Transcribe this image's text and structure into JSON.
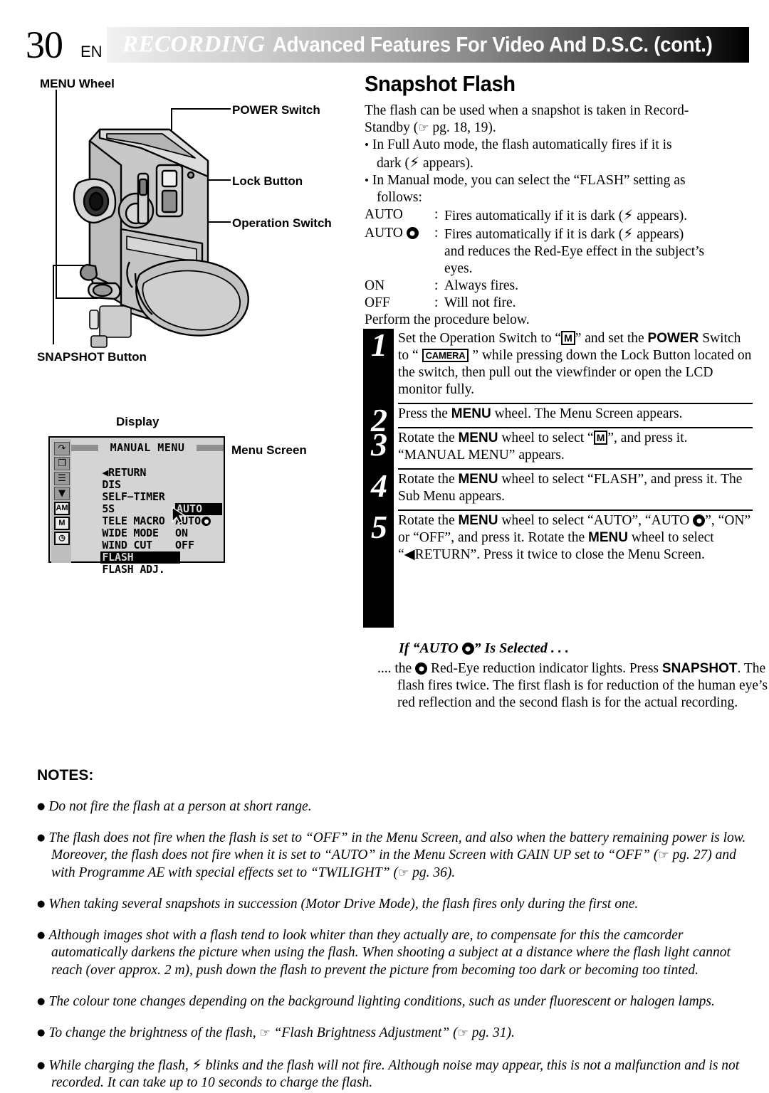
{
  "header": {
    "page_number": "30",
    "language": "EN",
    "title_italic": "RECORDING",
    "title_rest": "Advanced Features For Video And D.S.C. (cont.)"
  },
  "callouts": {
    "menu_wheel": "MENU Wheel",
    "power_switch": "POWER Switch",
    "lock_button": "Lock Button",
    "operation_switch": "Operation Switch",
    "snapshot_button": "SNAPSHOT Button",
    "display": "Display",
    "menu_screen": "Menu Screen"
  },
  "menu_screen": {
    "title": "MANUAL MENU",
    "side_icons": [
      "return-arrow-icon",
      "copy-icon",
      "camera-setup-icon",
      "system-icon",
      "auto-manual-icon",
      "manual-mode-icon",
      "clock-icon"
    ],
    "side_icon_glyphs": [
      "↵",
      "❐",
      "☰",
      "▼",
      "AM",
      "M",
      "◷"
    ],
    "rows": [
      {
        "label": "◀RETURN",
        "value": "",
        "label_highlight": false,
        "value_highlight": false
      },
      {
        "label": "DIS",
        "value": "",
        "label_highlight": false,
        "value_highlight": false
      },
      {
        "label": "SELF−TIMER",
        "value": "",
        "label_highlight": false,
        "value_highlight": false
      },
      {
        "label": "5S",
        "value": "",
        "label_highlight": false,
        "value_highlight": false
      },
      {
        "label": "TELE MACRO",
        "value": "AUTO",
        "label_highlight": false,
        "value_highlight": true
      },
      {
        "label": "WIDE MODE",
        "value": "AUTO",
        "value_eye": true,
        "label_highlight": false,
        "value_highlight": false
      },
      {
        "label": "WIND CUT",
        "value": "ON",
        "label_highlight": false,
        "value_highlight": false
      },
      {
        "label": "FLASH",
        "value": "OFF",
        "label_highlight": true,
        "value_highlight": false
      },
      {
        "label": "FLASH ADJ.",
        "value": "",
        "label_highlight": false,
        "value_highlight": false
      }
    ]
  },
  "main": {
    "heading": "Snapshot Flash",
    "intro_1": "The flash can be used when a snapshot is taken in Record-",
    "intro_2_prefix": "Standby (",
    "intro_2_suffix": " pg. 18, 19).",
    "bullet_1a": "In Full Auto mode, the flash automatically fires if it is",
    "bullet_1b_prefix": "dark (",
    "bullet_1b_suffix": " appears).",
    "bullet_2a": "In Manual mode, you can select the “FLASH” setting as",
    "bullet_2b": "follows:",
    "modes": [
      {
        "key": "AUTO",
        "key_eye": false,
        "colon": ":",
        "desc_pre": "Fires automatically if it is dark (",
        "desc_post": " appears)."
      },
      {
        "key": "AUTO",
        "key_eye": true,
        "colon": ":",
        "desc_pre": "Fires automatically if it is dark (",
        "desc_post": " appears)",
        "desc_line2": "and reduces the Red-Eye effect in the subject’s",
        "desc_line3": "eyes."
      },
      {
        "key": "ON",
        "key_eye": false,
        "colon": ":",
        "desc_plain": "Always fires."
      },
      {
        "key": "OFF",
        "key_eye": false,
        "colon": ":",
        "desc_plain": "Will not fire."
      }
    ],
    "perform": "Perform the procedure below."
  },
  "steps": [
    {
      "number": "1",
      "parts": [
        {
          "t": "text",
          "v": "Set the Operation Switch to “"
        },
        {
          "t": "boxM",
          "v": "M"
        },
        {
          "t": "text",
          "v": "” and set the "
        },
        {
          "t": "bold",
          "v": "POWER"
        },
        {
          "t": "text",
          "v": " Switch to “ "
        },
        {
          "t": "boxCAM",
          "v": "CAMERA"
        },
        {
          "t": "text",
          "v": " ” while pressing down the Lock Button located on the switch, then pull out the viewfinder or open the LCD monitor fully."
        }
      ]
    },
    {
      "number": "2",
      "parts": [
        {
          "t": "text",
          "v": "Press the "
        },
        {
          "t": "bold",
          "v": "MENU"
        },
        {
          "t": "text",
          "v": " wheel. The Menu Screen appears."
        }
      ]
    },
    {
      "number": "3",
      "parts": [
        {
          "t": "text",
          "v": "Rotate the "
        },
        {
          "t": "bold",
          "v": "MENU"
        },
        {
          "t": "text",
          "v": " wheel to select “"
        },
        {
          "t": "boxM",
          "v": "M"
        },
        {
          "t": "text",
          "v": "”, and press it. “MANUAL MENU” appears."
        }
      ]
    },
    {
      "number": "4",
      "parts": [
        {
          "t": "text",
          "v": "Rotate the "
        },
        {
          "t": "bold",
          "v": "MENU"
        },
        {
          "t": "text",
          "v": " wheel to select “FLASH”, and press it. The Sub Menu appears."
        }
      ]
    },
    {
      "number": "5",
      "parts": [
        {
          "t": "text",
          "v": "Rotate the "
        },
        {
          "t": "bold",
          "v": "MENU"
        },
        {
          "t": "text",
          "v": " wheel to select “AUTO”, “AUTO "
        },
        {
          "t": "eye",
          "v": ""
        },
        {
          "t": "text",
          "v": "”, “ON” or “OFF”, and press it. Rotate the "
        },
        {
          "t": "bold",
          "v": "MENU"
        },
        {
          "t": "text",
          "v": " wheel to select “◀RETURN”. Press it twice to close the Menu Screen."
        }
      ]
    }
  ],
  "if_auto": {
    "heading_pre": "If “AUTO ",
    "heading_post": "” Is Selected . . .",
    "body_parts": [
      {
        "t": "text",
        "v": ".... the "
      },
      {
        "t": "eye",
        "v": ""
      },
      {
        "t": "text",
        "v": " Red-Eye reduction indicator lights. Press "
      },
      {
        "t": "bold",
        "v": "SNAPSHOT"
      },
      {
        "t": "text",
        "v": ". The flash fires twice. The first flash is for reduction of the human eye’s red reflection and the second flash is for the actual recording."
      }
    ]
  },
  "notes": {
    "title": "NOTES:",
    "items": [
      [
        {
          "t": "text",
          "v": "Do not fire the flash at a person at short range."
        }
      ],
      [
        {
          "t": "text",
          "v": "The flash does not fire when the flash is set to “OFF” in the Menu Screen, and also when the battery remaining power is low. Moreover, the flash does not fire when it is set to “AUTO” in the Menu Screen with GAIN UP set to “OFF” ("
        },
        {
          "t": "hand",
          "v": ""
        },
        {
          "t": "text",
          "v": " pg. 27) and with Programme AE with special effects set to “TWILIGHT” ("
        },
        {
          "t": "hand",
          "v": ""
        },
        {
          "t": "text",
          "v": " pg. 36)."
        }
      ],
      [
        {
          "t": "text",
          "v": "When taking several snapshots in succession (Motor Drive Mode), the flash fires only during the first one."
        }
      ],
      [
        {
          "t": "text",
          "v": "Although images shot with a flash tend to look whiter than they actually are, to compensate for this the camcorder automatically darkens the picture when using the flash. When shooting a subject at a distance where the flash light cannot reach (over approx. 2 m), push down the flash to prevent the picture from becoming too dark or becoming too tinted."
        }
      ],
      [
        {
          "t": "text",
          "v": "The colour tone changes depending on the background lighting conditions, such as under fluorescent or halogen lamps."
        }
      ],
      [
        {
          "t": "text",
          "v": "To change the brightness of the flash, "
        },
        {
          "t": "hand",
          "v": ""
        },
        {
          "t": "text",
          "v": " “Flash Brightness Adjustment” ("
        },
        {
          "t": "hand",
          "v": ""
        },
        {
          "t": "text",
          "v": " pg. 31)."
        }
      ],
      [
        {
          "t": "text",
          "v": "While charging the flash, "
        },
        {
          "t": "flash",
          "v": ""
        },
        {
          "t": "text",
          "v": " blinks and the flash will not fire. Although noise may appear, this is not a malfunction and is not recorded. It can take up to 10 seconds to charge the flash."
        }
      ]
    ]
  },
  "colors": {
    "banner_start": "#f2f2f2",
    "banner_end": "#000000",
    "menu_bg": "#d4d4d4",
    "menu_side_bg": "#bdbdbd",
    "highlight_bg": "#000000"
  }
}
